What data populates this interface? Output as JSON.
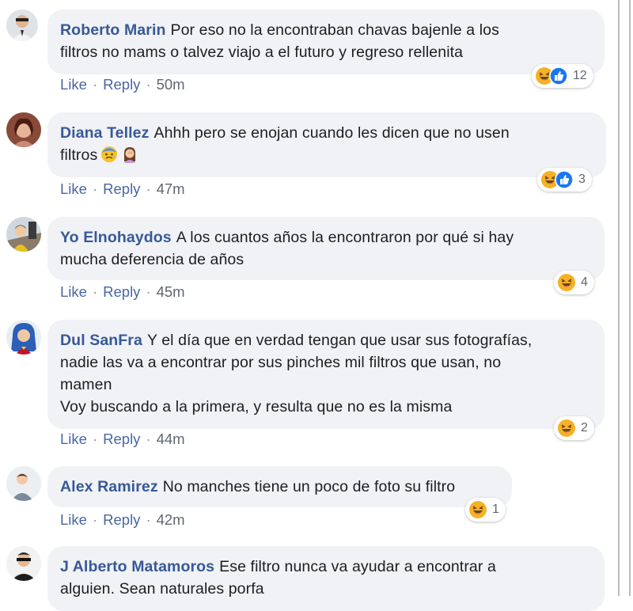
{
  "comments": [
    {
      "author": "Roberto Marin",
      "text": "Por eso no la encontraban chavas bajenle a los\nfiltros no mams o talvez viajo a el futuro y regreso rellenita",
      "like": "Like",
      "reply": "Reply",
      "time": "50m",
      "reactions": [
        "haha-icon",
        "like-icon"
      ],
      "count": "12"
    },
    {
      "author": "Diana Tellez",
      "text": "Ahhh pero se enojan cuando les dicen que no usen\nfiltros",
      "emojis": [
        "anxious-face-emoji",
        "woman-facepalming-emoji"
      ],
      "like": "Like",
      "reply": "Reply",
      "time": "47m",
      "reactions": [
        "haha-icon",
        "like-icon"
      ],
      "count": "3"
    },
    {
      "author": "Yo Elnohaydos",
      "text": "A los cuantos años la encontraron por qué si hay\nmucha deferencia de años",
      "like": "Like",
      "reply": "Reply",
      "time": "45m",
      "reactions": [
        "haha-icon"
      ],
      "count": "4"
    },
    {
      "author": "Dul SanFra",
      "text": "Y el día que en verdad tengan que usar sus fotografías,\nnadie las va a encontrar por sus pinches mil filtros que usan, no\nmamen\nVoy buscando a la primera, y resulta que no es la misma",
      "like": "Like",
      "reply": "Reply",
      "time": "44m",
      "reactions": [
        "haha-icon"
      ],
      "count": "2"
    },
    {
      "author": "Alex Ramirez",
      "text": "No manches tiene un poco de foto su filtro",
      "like": "Like",
      "reply": "Reply",
      "time": "42m",
      "reactions": [
        "haha-icon"
      ],
      "count": "1"
    },
    {
      "author": "J Alberto Matamoros",
      "text": "Ese filtro nunca va ayudar a encontrar a\nalguien. Sean naturales porfa"
    }
  ],
  "colors": {
    "author": "#385898",
    "bubble": "#f0f2f5",
    "link": "#4b67a1",
    "like_blue": "#1877f2",
    "haha_yellow": "#f7b125"
  }
}
